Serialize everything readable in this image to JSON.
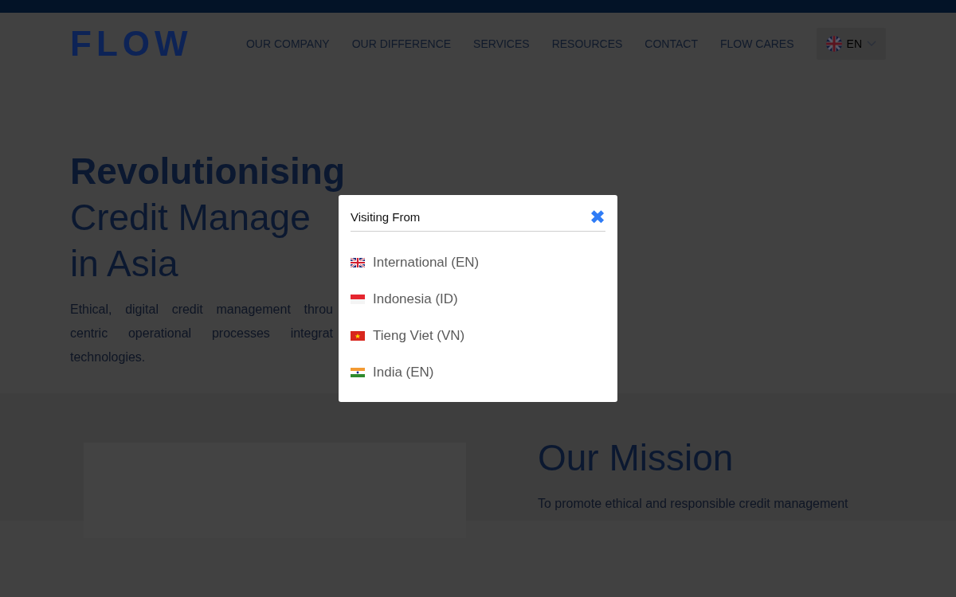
{
  "header": {
    "logo": "FLOW",
    "nav": [
      {
        "label": "OUR COMPANY"
      },
      {
        "label": "OUR DIFFERENCE"
      },
      {
        "label": "SERVICES"
      },
      {
        "label": "RESOURCES"
      },
      {
        "label": "CONTACT"
      },
      {
        "label": "FLOW CARES"
      }
    ],
    "language": {
      "label": "EN",
      "kind": "uk"
    }
  },
  "hero": {
    "title_bold": "Revolutionising",
    "title_lines": [
      "Credit Manage",
      "in Asia"
    ],
    "text_lines": [
      "Ethical, digital credit management throu",
      "centric operational processes integrat",
      "technologies."
    ]
  },
  "mission": {
    "title": "Our Mission",
    "text": "To promote ethical and responsible credit management"
  },
  "modal": {
    "title": "Visiting From",
    "close": "✖",
    "items": [
      {
        "label": "International (EN)",
        "kind": "uk"
      },
      {
        "label": "Indonesia (ID)",
        "kind": "id"
      },
      {
        "label": "Tieng Viet (VN)",
        "kind": "vn"
      },
      {
        "label": "India (EN)",
        "kind": "in"
      }
    ]
  }
}
